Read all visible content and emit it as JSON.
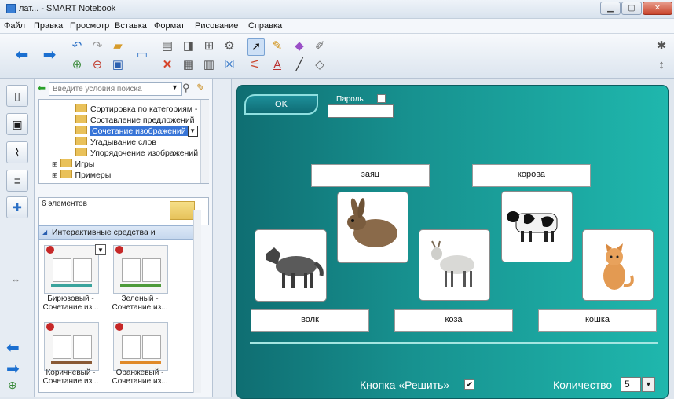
{
  "window": {
    "title": "лат... - SMART Notebook"
  },
  "menu": [
    "Файл",
    "Правка",
    "Просмотр",
    "Вставка",
    "Формат",
    "Рисование",
    "Справка"
  ],
  "sidebar": {
    "search_placeholder": "Введите условия поиска",
    "tree_items": [
      "Сортировка по категориям - т",
      "Составление предложений",
      "Сочетание изображений",
      "Угадывание слов",
      "Упорядочение изображений",
      "Игры",
      "Примеры"
    ],
    "count_text": "6 элементов",
    "group_header": "Интерактивные средства и мультиме...",
    "thumbnails": [
      {
        "line1": "Бирюзовый -",
        "line2": "Сочетание из...",
        "color": "#3aa39c"
      },
      {
        "line1": "Зеленый -",
        "line2": "Сочетание из...",
        "color": "#4d9a3a"
      },
      {
        "line1": "Коричневый -",
        "line2": "Сочетание из...",
        "color": "#8a5a35"
      },
      {
        "line1": "Оранжевый -",
        "line2": "Сочетание из...",
        "color": "#e08a2a"
      }
    ]
  },
  "activity": {
    "ok_label": "OK",
    "password_label": "Пароль",
    "words": [
      "заяц",
      "корова",
      "волк",
      "коза",
      "кошка"
    ],
    "images": [
      "rabbit-image",
      "cow-image",
      "wolf-image",
      "goat-image",
      "cat-image"
    ],
    "solve_label": "Кнопка «Решить»",
    "solve_checked": "✔",
    "count_label": "Количество",
    "count_value": "5"
  },
  "colors": {
    "page_start": "#0f6e72",
    "page_end": "#1fb7ad",
    "accent": "#3875d7"
  }
}
